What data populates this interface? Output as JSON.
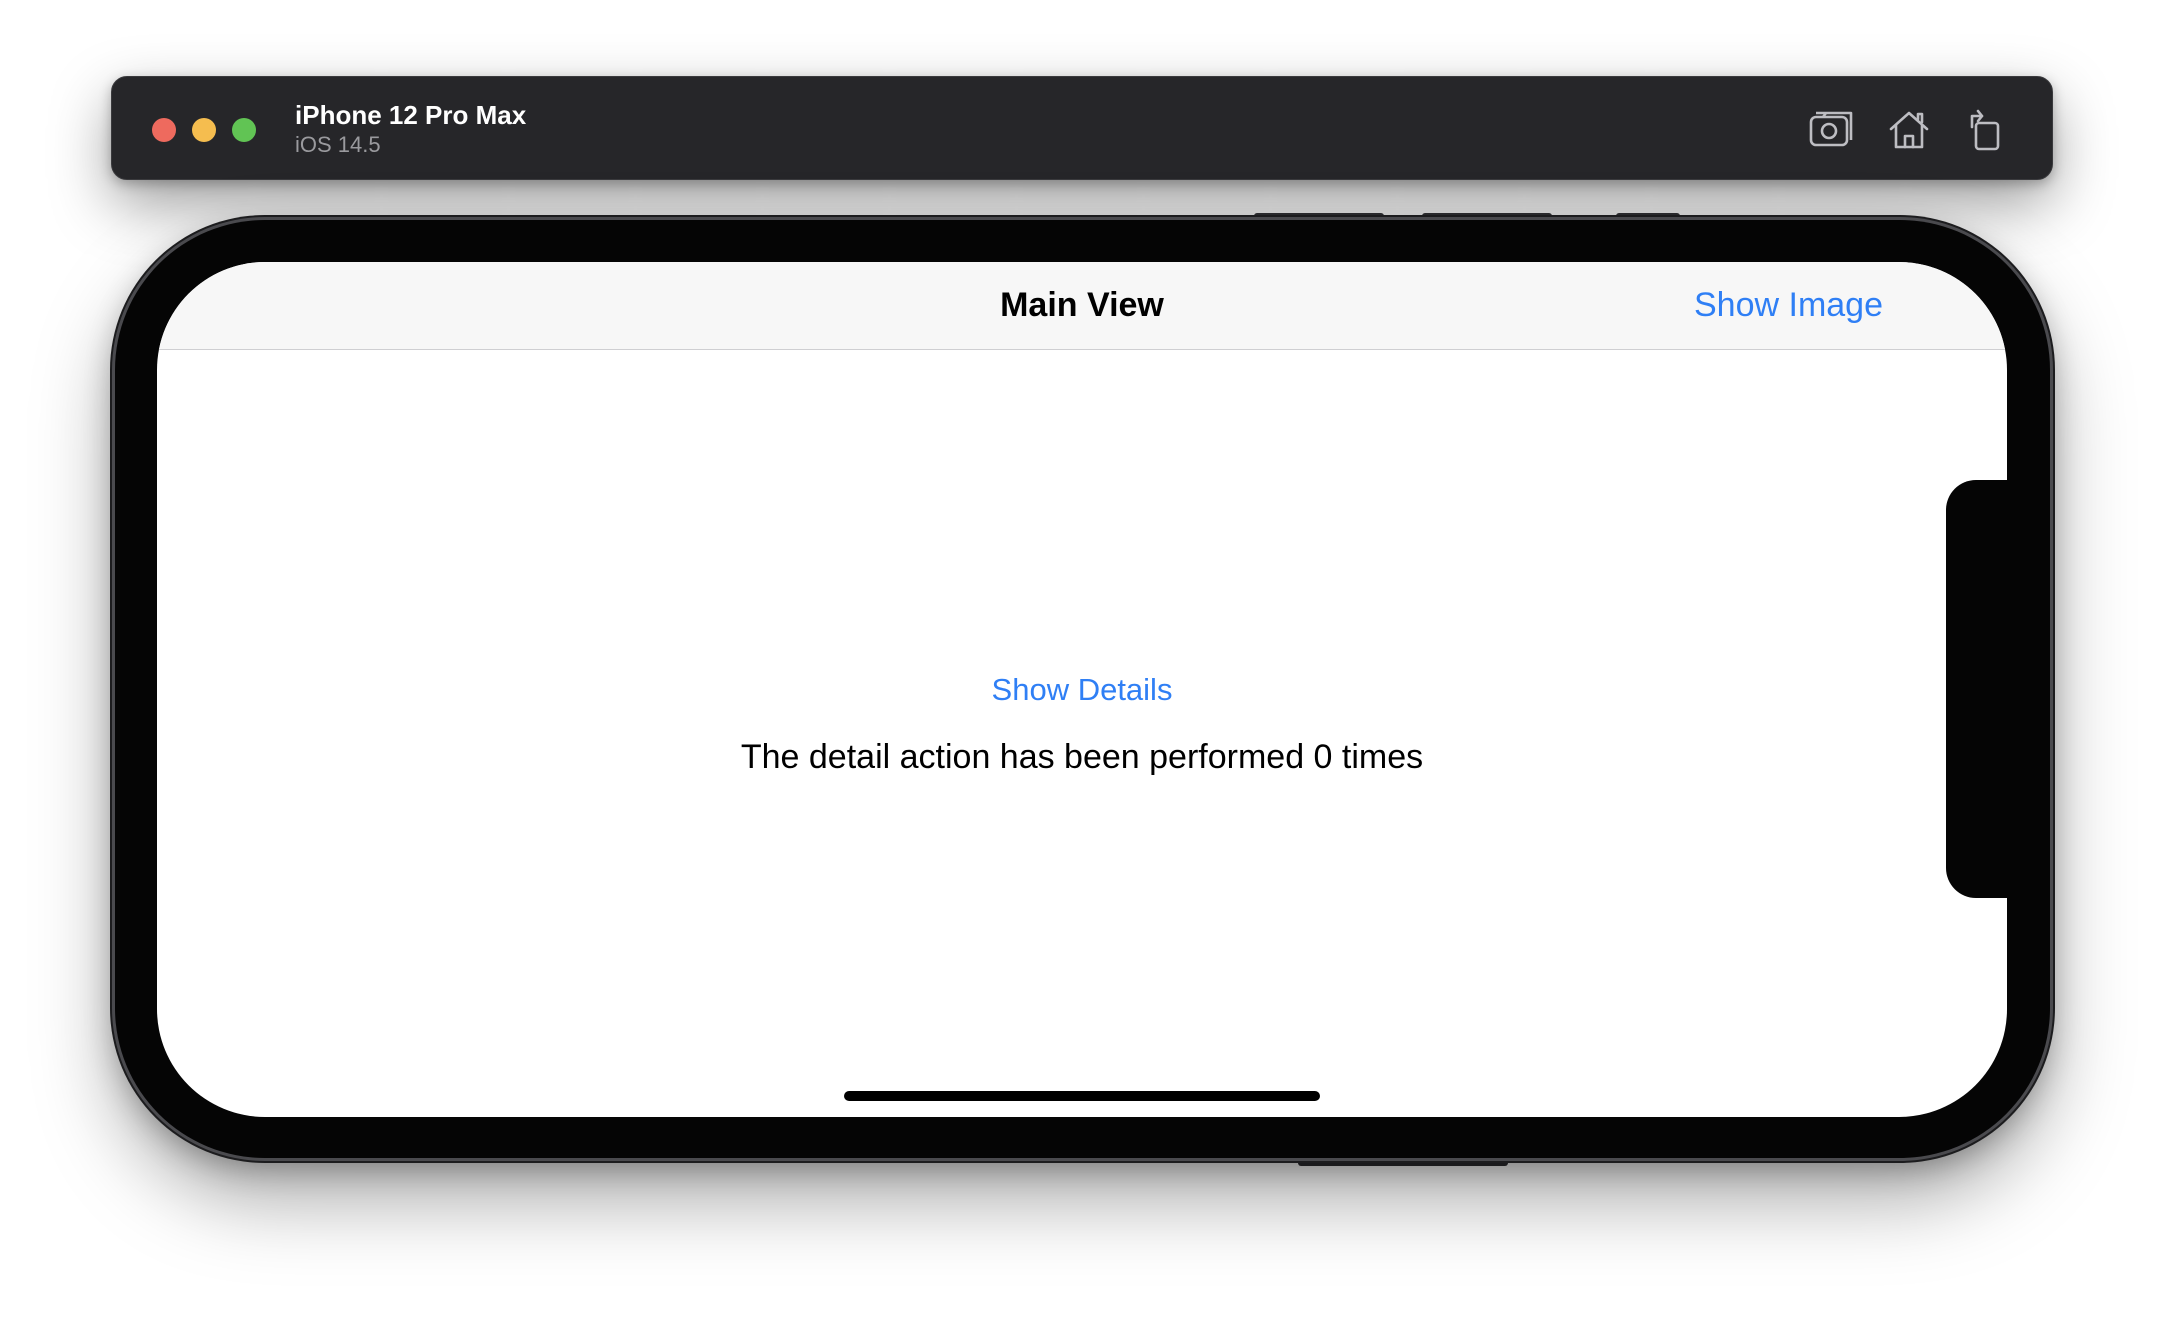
{
  "simulator": {
    "device_name": "iPhone 12 Pro Max",
    "os_version": "iOS 14.5",
    "toolbar_icons": [
      "screenshot-icon",
      "home-icon",
      "rotate-icon"
    ],
    "window_controls": [
      "close",
      "minimize",
      "zoom"
    ]
  },
  "app": {
    "nav_title": "Main View",
    "nav_right_button": "Show Image",
    "show_details_button": "Show Details",
    "detail_count_text": "The detail action has been performed 0 times"
  },
  "colors": {
    "accent": "#2f7ff5",
    "titlebar": "#262629",
    "close": "#ee6a5e",
    "minimize": "#f5bd4f",
    "zoom": "#61c454"
  }
}
